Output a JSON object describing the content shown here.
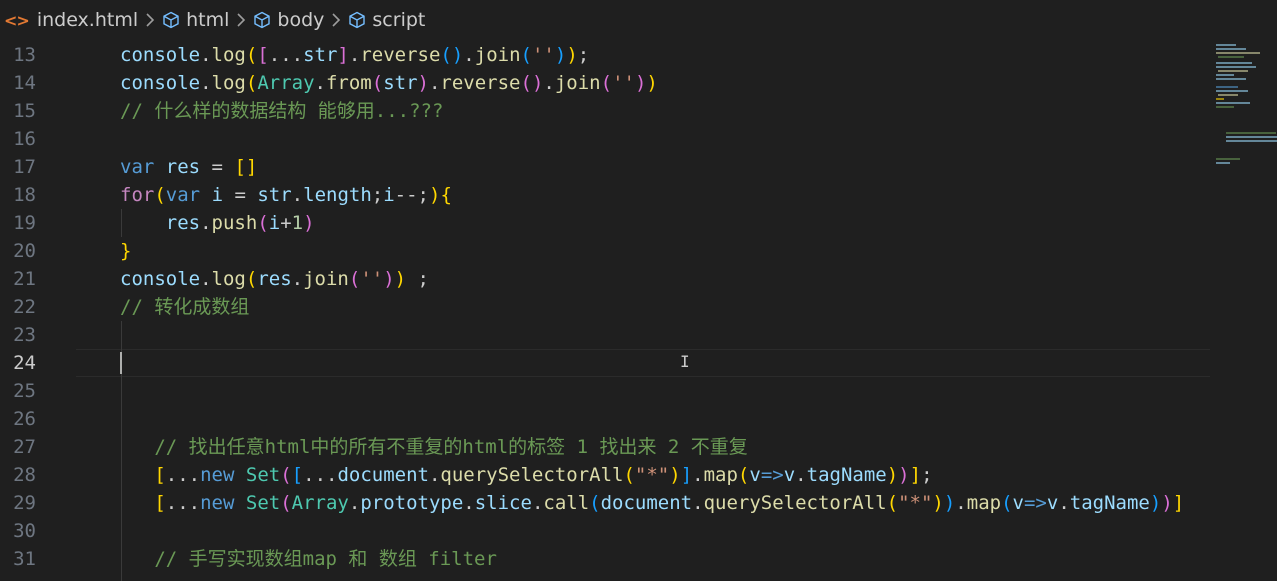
{
  "breadcrumb": {
    "file": "index.html",
    "items": [
      "html",
      "body",
      "script"
    ]
  },
  "editor": {
    "active_line": "24",
    "lines": [
      {
        "num": "13",
        "tokens": [
          [
            "v",
            "console"
          ],
          [
            "p",
            "."
          ],
          [
            "f",
            "log"
          ],
          [
            "b1",
            "("
          ],
          [
            "b2",
            "["
          ],
          [
            "p",
            "..."
          ],
          [
            "v",
            "str"
          ],
          [
            "b2",
            "]"
          ],
          [
            "p",
            "."
          ],
          [
            "f",
            "reverse"
          ],
          [
            "b3",
            "()"
          ],
          [
            "p",
            "."
          ],
          [
            "f",
            "join"
          ],
          [
            "b3",
            "("
          ],
          [
            "s",
            "''"
          ],
          [
            "b3",
            ")"
          ],
          [
            "b1",
            ")"
          ],
          [
            "p",
            ";"
          ]
        ]
      },
      {
        "num": "14",
        "tokens": [
          [
            "v",
            "console"
          ],
          [
            "p",
            "."
          ],
          [
            "f",
            "log"
          ],
          [
            "b1",
            "("
          ],
          [
            "t",
            "Array"
          ],
          [
            "p",
            "."
          ],
          [
            "f",
            "from"
          ],
          [
            "b2",
            "("
          ],
          [
            "v",
            "str"
          ],
          [
            "b2",
            ")"
          ],
          [
            "p",
            "."
          ],
          [
            "f",
            "reverse"
          ],
          [
            "b2",
            "()"
          ],
          [
            "p",
            "."
          ],
          [
            "f",
            "join"
          ],
          [
            "b2",
            "("
          ],
          [
            "s",
            "''"
          ],
          [
            "b2",
            ")"
          ],
          [
            "b1",
            ")"
          ]
        ]
      },
      {
        "num": "15",
        "tokens": [
          [
            "c",
            "// 什么样的数据结构 能够用...???"
          ]
        ]
      },
      {
        "num": "16",
        "tokens": []
      },
      {
        "num": "17",
        "tokens": [
          [
            "k",
            "var"
          ],
          [
            "p",
            " "
          ],
          [
            "v",
            "res"
          ],
          [
            "p",
            " = "
          ],
          [
            "b1",
            "[]"
          ]
        ]
      },
      {
        "num": "18",
        "tokens": [
          [
            "kf",
            "for"
          ],
          [
            "b1",
            "("
          ],
          [
            "k",
            "var"
          ],
          [
            "p",
            " "
          ],
          [
            "v",
            "i"
          ],
          [
            "p",
            " = "
          ],
          [
            "v",
            "str"
          ],
          [
            "p",
            "."
          ],
          [
            "v",
            "length"
          ],
          [
            "p",
            ";"
          ],
          [
            "v",
            "i"
          ],
          [
            "p",
            "--;"
          ],
          [
            "b1",
            ")"
          ],
          [
            "b1",
            "{"
          ]
        ]
      },
      {
        "num": "19",
        "tokens": [
          [
            "p",
            "    "
          ],
          [
            "v",
            "res"
          ],
          [
            "p",
            "."
          ],
          [
            "f",
            "push"
          ],
          [
            "b2",
            "("
          ],
          [
            "v",
            "i"
          ],
          [
            "p",
            "+"
          ],
          [
            "n",
            "1"
          ],
          [
            "b2",
            ")"
          ]
        ]
      },
      {
        "num": "20",
        "tokens": [
          [
            "b1",
            "}"
          ]
        ]
      },
      {
        "num": "21",
        "tokens": [
          [
            "v",
            "console"
          ],
          [
            "p",
            "."
          ],
          [
            "f",
            "log"
          ],
          [
            "b1",
            "("
          ],
          [
            "v",
            "res"
          ],
          [
            "p",
            "."
          ],
          [
            "f",
            "join"
          ],
          [
            "b2",
            "("
          ],
          [
            "s",
            "''"
          ],
          [
            "b2",
            ")"
          ],
          [
            "b1",
            ")"
          ],
          [
            "p",
            " ;"
          ]
        ]
      },
      {
        "num": "22",
        "tokens": [
          [
            "c",
            "// 转化成数组"
          ]
        ]
      },
      {
        "num": "23",
        "tokens": []
      },
      {
        "num": "24",
        "tokens": []
      },
      {
        "num": "25",
        "tokens": []
      },
      {
        "num": "26",
        "tokens": []
      },
      {
        "num": "27",
        "tokens": [
          [
            "p",
            "   "
          ],
          [
            "c",
            "// 找出任意html中的所有不重复的html的标签 1 找出来 2 不重复"
          ]
        ]
      },
      {
        "num": "28",
        "tokens": [
          [
            "p",
            "   "
          ],
          [
            "b1",
            "["
          ],
          [
            "p",
            "..."
          ],
          [
            "k",
            "new"
          ],
          [
            "p",
            " "
          ],
          [
            "t",
            "Set"
          ],
          [
            "b2",
            "("
          ],
          [
            "b3",
            "["
          ],
          [
            "p",
            "..."
          ],
          [
            "v",
            "document"
          ],
          [
            "p",
            "."
          ],
          [
            "f",
            "querySelectorAll"
          ],
          [
            "b1",
            "("
          ],
          [
            "s",
            "\"*\""
          ],
          [
            "b1",
            ")"
          ],
          [
            "b3",
            "]"
          ],
          [
            "p",
            "."
          ],
          [
            "f",
            "map"
          ],
          [
            "b1",
            "("
          ],
          [
            "v",
            "v"
          ],
          [
            "k",
            "=>"
          ],
          [
            "v",
            "v"
          ],
          [
            "p",
            "."
          ],
          [
            "v",
            "tagName"
          ],
          [
            "b1",
            ")"
          ],
          [
            "b2",
            ")"
          ],
          [
            "b1",
            "]"
          ],
          [
            "p",
            ";"
          ]
        ]
      },
      {
        "num": "29",
        "tokens": [
          [
            "p",
            "   "
          ],
          [
            "b1",
            "["
          ],
          [
            "p",
            "..."
          ],
          [
            "k",
            "new"
          ],
          [
            "p",
            " "
          ],
          [
            "t",
            "Set"
          ],
          [
            "b2",
            "("
          ],
          [
            "t",
            "Array"
          ],
          [
            "p",
            "."
          ],
          [
            "v",
            "prototype"
          ],
          [
            "p",
            "."
          ],
          [
            "v",
            "slice"
          ],
          [
            "p",
            "."
          ],
          [
            "f",
            "call"
          ],
          [
            "b3",
            "("
          ],
          [
            "v",
            "document"
          ],
          [
            "p",
            "."
          ],
          [
            "f",
            "querySelectorAll"
          ],
          [
            "b1",
            "("
          ],
          [
            "s",
            "\"*\""
          ],
          [
            "b1",
            ")"
          ],
          [
            "b3",
            ")"
          ],
          [
            "p",
            "."
          ],
          [
            "f",
            "map"
          ],
          [
            "b3",
            "("
          ],
          [
            "v",
            "v"
          ],
          [
            "k",
            "=>"
          ],
          [
            "v",
            "v"
          ],
          [
            "p",
            "."
          ],
          [
            "v",
            "tagName"
          ],
          [
            "b3",
            ")"
          ],
          [
            "b2",
            ")"
          ],
          [
            "b1",
            "]"
          ]
        ]
      },
      {
        "num": "30",
        "tokens": []
      },
      {
        "num": "31",
        "tokens": [
          [
            "p",
            "   "
          ],
          [
            "c",
            "// 手写实现数组map 和 数组 filter"
          ]
        ]
      }
    ]
  }
}
